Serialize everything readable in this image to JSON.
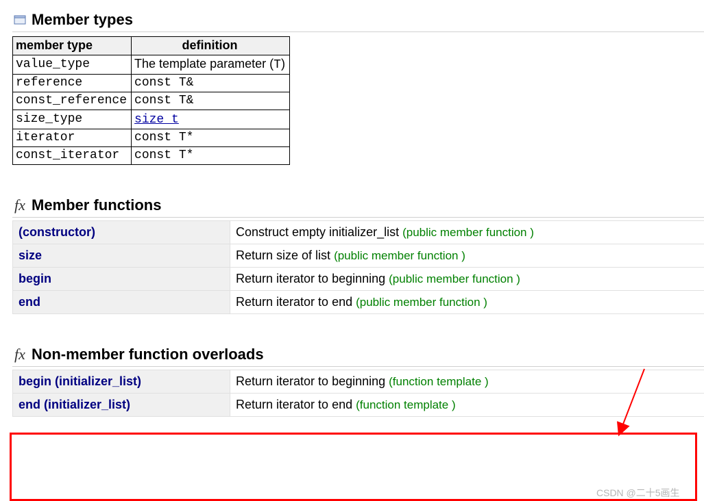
{
  "sections": {
    "member_types": {
      "title": "Member types"
    },
    "member_functions": {
      "title": "Member functions"
    },
    "nonmember": {
      "title": "Non-member function overloads"
    }
  },
  "member_types_table": {
    "headers": [
      "member type",
      "definition"
    ],
    "rows": [
      {
        "name": "value_type",
        "def_prefix": "The template parameter (",
        "def_code": "T",
        "def_suffix": ")",
        "plain": true
      },
      {
        "name": "reference",
        "def_mono": "const T&"
      },
      {
        "name": "const_reference",
        "def_mono": "const T&"
      },
      {
        "name": "size_type",
        "def_link": "size_t"
      },
      {
        "name": "iterator",
        "def_mono": "const T*"
      },
      {
        "name": "const_iterator",
        "def_mono": "const T*"
      }
    ]
  },
  "member_functions": [
    {
      "name": "(constructor)",
      "desc": "Construct empty initializer_list ",
      "tag": "(public member function )"
    },
    {
      "name": "size",
      "desc": "Return size of list ",
      "tag": "(public member function )"
    },
    {
      "name": "begin",
      "desc": "Return iterator to beginning ",
      "tag": "(public member function )"
    },
    {
      "name": "end",
      "desc": "Return iterator to end ",
      "tag": "(public member function )"
    }
  ],
  "nonmember_functions": [
    {
      "name": "begin (initializer_list)",
      "desc": "Return iterator to beginning ",
      "tag": "(function template )"
    },
    {
      "name": "end (initializer_list)",
      "desc": "Return iterator to end ",
      "tag": "(function template )"
    }
  ],
  "watermark": "CSDN @二十5画生"
}
